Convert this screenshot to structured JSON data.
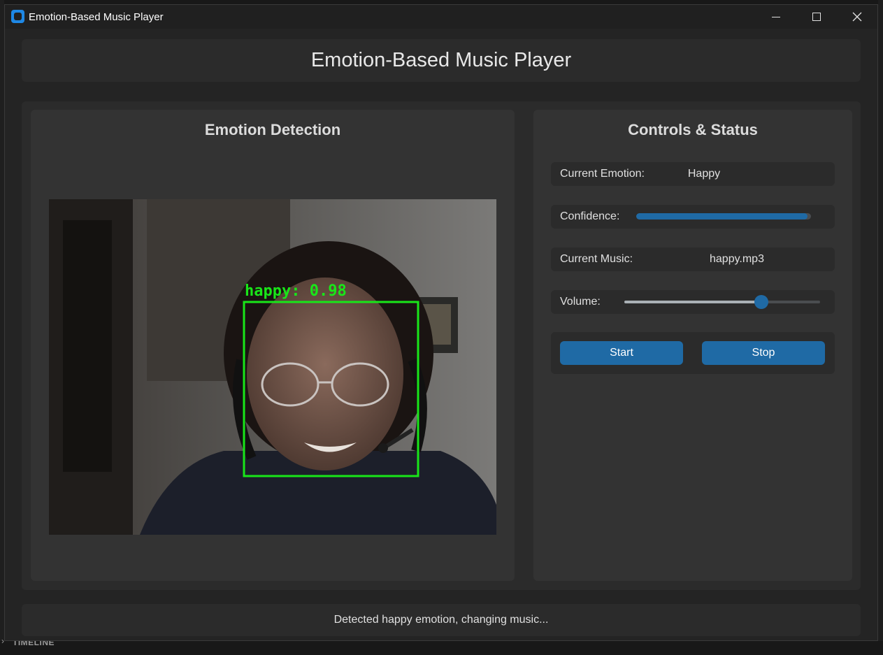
{
  "window": {
    "title": "Emotion-Based Music Player"
  },
  "header": {
    "title": "Emotion-Based Music Player"
  },
  "detection": {
    "title": "Emotion Detection",
    "overlay_label": "happy: 0.98",
    "overlay_color": "#19e619"
  },
  "controls": {
    "title": "Controls & Status",
    "emotion_label": "Current Emotion:",
    "emotion_value": "Happy",
    "confidence_label": "Confidence:",
    "confidence_fraction": 0.98,
    "music_label": "Current Music:",
    "music_value": "happy.mp3",
    "volume_label": "Volume:",
    "volume_fraction": 0.7,
    "start_label": "Start",
    "stop_label": "Stop"
  },
  "status": {
    "text": "Detected happy emotion, changing music..."
  },
  "background": {
    "timeline_label": "TIMELINE"
  },
  "colors": {
    "accent": "#1f6aa5",
    "panel": "#2b2b2b",
    "inner_panel": "#333333"
  },
  "icons": {
    "app": "app-icon",
    "minimize": "minimize-icon",
    "maximize": "maximize-icon",
    "close": "close-icon"
  }
}
